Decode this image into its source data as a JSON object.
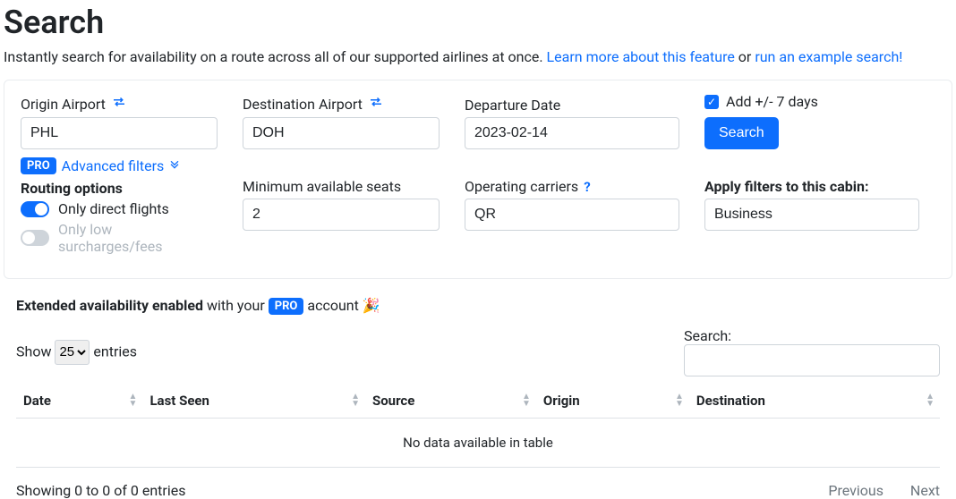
{
  "title": "Search",
  "intro": {
    "text": "Instantly search for availability on a route across all of our supported airlines at once. ",
    "learn_more": "Learn more about this feature",
    "or": " or ",
    "run_example": "run an example search!"
  },
  "form": {
    "origin": {
      "label": "Origin Airport",
      "value": "PHL"
    },
    "destination": {
      "label": "Destination Airport",
      "value": "DOH"
    },
    "departure": {
      "label": "Departure Date",
      "value": "2023-02-14"
    },
    "add_days": {
      "label": "Add +/- 7 days",
      "checked": true
    },
    "search_button": "Search",
    "pro_badge": "PRO",
    "advanced_filters": "Advanced filters",
    "routing_heading": "Routing options",
    "toggle_direct": "Only direct flights",
    "toggle_low_fees": "Only low surcharges/fees",
    "min_seats": {
      "label": "Minimum available seats",
      "value": "2"
    },
    "carriers": {
      "label": "Operating carriers",
      "value": "QR"
    },
    "cabin": {
      "label": "Apply filters to this cabin:",
      "value": "Business"
    }
  },
  "extended": {
    "bold": "Extended availability enabled",
    "rest": " with your ",
    "pro": "PRO",
    "tail": " account 🎉"
  },
  "table": {
    "show": "Show",
    "length_value": "25",
    "entries": "entries",
    "search_label": "Search:",
    "columns": [
      "Date",
      "Last Seen",
      "Source",
      "Origin",
      "Destination"
    ],
    "empty": "No data available in table",
    "info": "Showing 0 to 0 of 0 entries",
    "prev": "Previous",
    "next": "Next"
  }
}
